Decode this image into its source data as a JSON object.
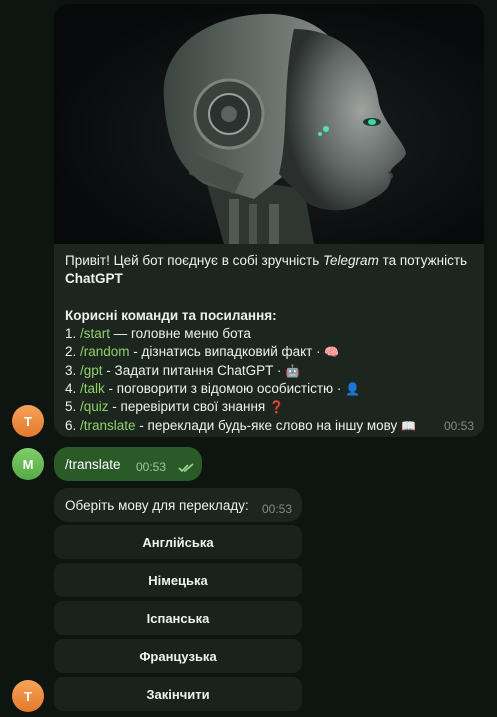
{
  "chat": {
    "bot_avatar_letter": "T",
    "user_avatar_letter": "M",
    "main_message": {
      "line1_prefix": "Привіт! Цей бот поєднує в собі зручність ",
      "line1_italic": "Telegram",
      "line1_suffix": " та потужність",
      "line2": "ChatGPT",
      "heading": "Корисні команди та посилання:",
      "commands": [
        {
          "num": "1. ",
          "cmd": "/start",
          "desc": " — головне меню бота",
          "emoji": ""
        },
        {
          "num": "2. ",
          "cmd": "/random",
          "desc": " - дізнатись випадковий факт · ",
          "emoji": "🧠"
        },
        {
          "num": "3. ",
          "cmd": "/gpt",
          "desc": " - Задати питання ChatGPT · ",
          "emoji": "🤖"
        },
        {
          "num": "4. ",
          "cmd": "/talk",
          "desc": " - поговорити з відомою особистістю · ",
          "emoji": "👤"
        },
        {
          "num": "5. ",
          "cmd": "/quiz",
          "desc": " - перевірити свої знання ",
          "emoji": "❓"
        },
        {
          "num": "6. ",
          "cmd": "/translate",
          "desc": " - переклади будь-яке слово на іншу мову ",
          "emoji": "📖"
        }
      ],
      "time": "00:53"
    },
    "user_message": {
      "text": "/translate",
      "time": "00:53"
    },
    "prompt_message": {
      "text": "Оберіть мову для перекладу:",
      "time": "00:53"
    },
    "keyboard": [
      "Англійська",
      "Німецька",
      "Іспанська",
      "Французька",
      "Закінчити"
    ]
  },
  "colors": {
    "command": "#8fd16a",
    "outgoing_bubble": "#2b5a29",
    "incoming_bubble": "#1d261e",
    "background": "#0e1410"
  }
}
